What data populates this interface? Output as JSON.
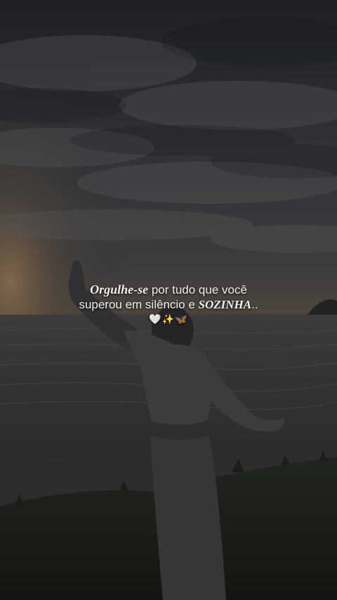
{
  "caption": {
    "emphasis_start": "Orgulhe-se",
    "line1_rest": " por tudo que você",
    "line2_start": "superou em silêncio e ",
    "emphasis_end": "SOZINHA",
    "line2_end": "..",
    "emoji": "🤍✨🦋"
  },
  "colors": {
    "sky_top": "#2a2d33",
    "sky_mid": "#4a4a4c",
    "horizon_glow": "#8a6a4a",
    "sea": "#3a3a3d",
    "grass": "#1f231d",
    "caption_text": "#f2efe9"
  }
}
